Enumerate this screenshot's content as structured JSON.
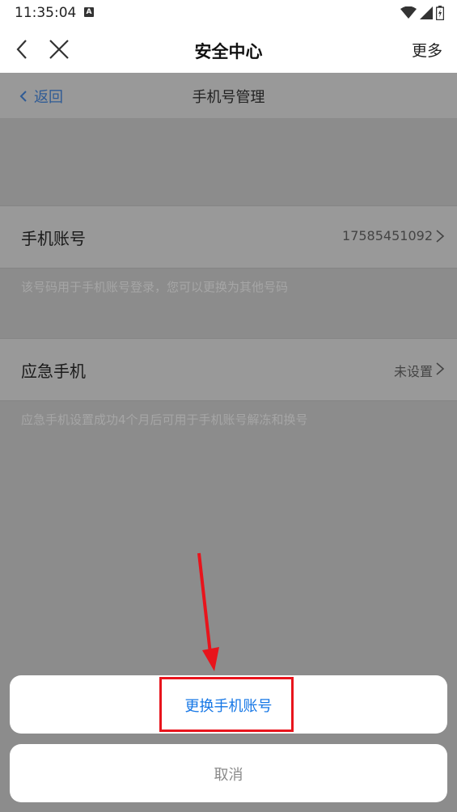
{
  "status_bar": {
    "time": "11:35:04",
    "badge": "A"
  },
  "header": {
    "title": "安全中心",
    "more": "更多"
  },
  "subnav": {
    "back": "返回",
    "title": "手机号管理"
  },
  "phone_account": {
    "label": "手机账号",
    "value": "17585451092",
    "hint": "该号码用于手机账号登录，您可以更换为其他号码"
  },
  "emergency_phone": {
    "label": "应急手机",
    "value": "未设置",
    "hint": "应急手机设置成功4个月后可用于手机账号解冻和换号"
  },
  "action_sheet": {
    "change": "更换手机账号",
    "cancel": "取消"
  },
  "colors": {
    "accent": "#1677e6",
    "annotation": "#e8141c"
  }
}
